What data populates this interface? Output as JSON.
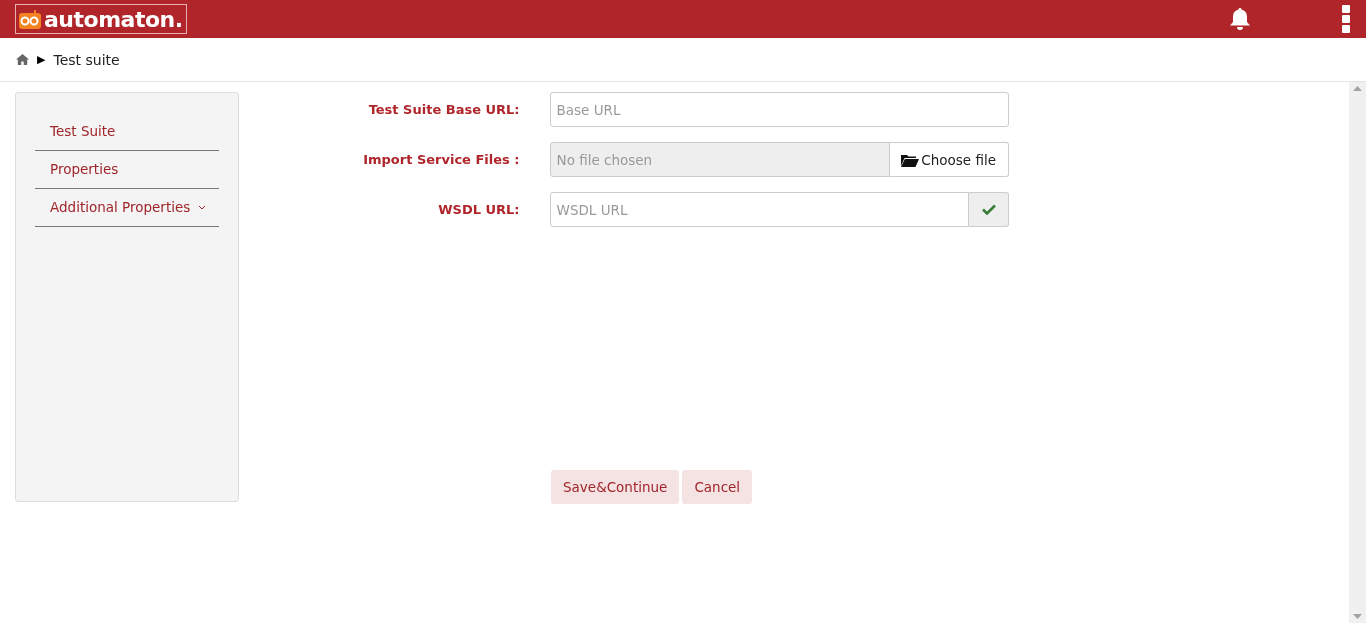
{
  "header": {
    "logo": "automaton."
  },
  "breadcrumb": {
    "separator": "▶",
    "current": "Test suite"
  },
  "sidebar": {
    "items": [
      {
        "label": "Test Suite",
        "has_submenu": false
      },
      {
        "label": "Properties",
        "has_submenu": false
      },
      {
        "label": "Additional Properties",
        "has_submenu": true
      }
    ]
  },
  "form": {
    "fields": [
      {
        "kind": "text",
        "label": "Test Suite Base URL:",
        "placeholder": "Base URL"
      },
      {
        "kind": "file",
        "label": "Import Service Files :",
        "placeholder": "No file chosen",
        "button": "Choose file"
      },
      {
        "kind": "text-check",
        "label": "WSDL URL:",
        "placeholder": "WSDL URL"
      }
    ],
    "buttons": [
      "Save&Continue",
      "Cancel"
    ]
  }
}
